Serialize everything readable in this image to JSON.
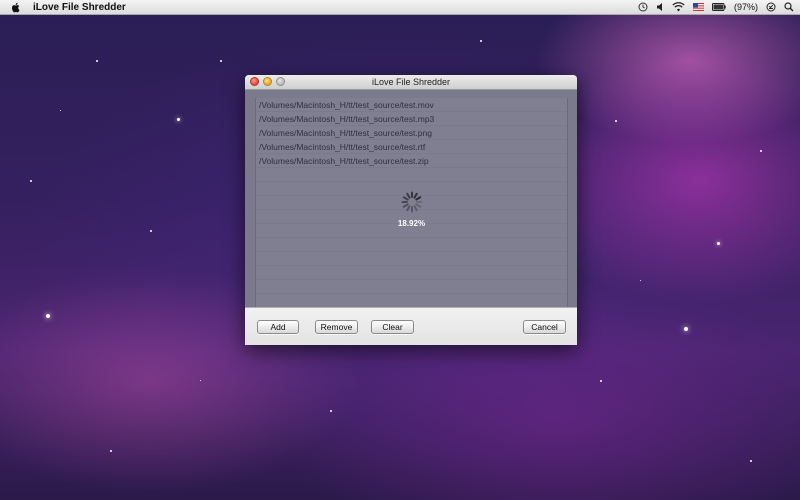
{
  "menubar": {
    "app_name": "iLove File Shredder",
    "battery_text": "(97%)"
  },
  "window": {
    "title": "iLove File Shredder",
    "files": [
      "/Volumes/Macintosh_H/tt/test_source/test.mov",
      "/Volumes/Macintosh_H/tt/test_source/test.mp3",
      "/Volumes/Macintosh_H/tt/test_source/test.png",
      "/Volumes/Macintosh_H/tt/test_source/test.rtf",
      "/Volumes/Macintosh_H/tt/test_source/test.zip"
    ],
    "progress_text": "18.92%",
    "progress_value": 0.1892,
    "buttons": {
      "add": "Add",
      "remove": "Remove",
      "clear": "Clear",
      "cancel": "Cancel"
    }
  },
  "colors": {
    "list_background": "#7a7a8c",
    "progress_text": "#ffffff"
  }
}
